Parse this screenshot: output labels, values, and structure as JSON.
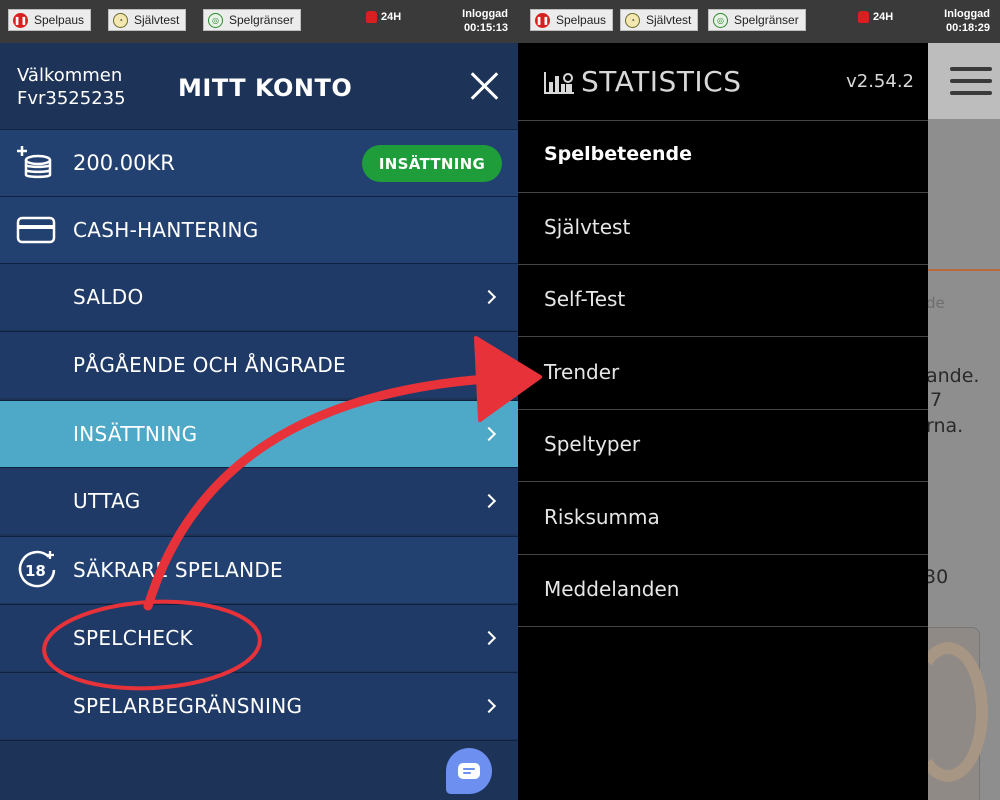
{
  "topbar_left": {
    "spelpaus": "Spelpaus",
    "sjalvtest": "Självtest",
    "spelgranser": "Spelgränser",
    "h24": "24H",
    "login_label": "Inloggad",
    "login_time": "00:15:13"
  },
  "topbar_right": {
    "spelpaus": "Spelpaus",
    "sjalvtest": "Självtest",
    "spelgranser": "Spelgränser",
    "h24": "24H",
    "login_label": "Inloggad",
    "login_time": "00:18:29"
  },
  "menu": {
    "welcome": "Välkommen",
    "username": "Fvr3525235",
    "title": "MITT KONTO",
    "balance": "200.00KR",
    "deposit_button": "INSÄTTNING",
    "items": [
      {
        "label": "CASH-HANTERING"
      },
      {
        "label": "SALDO"
      },
      {
        "label": "PÅGÅENDE OCH ÅNGRADE"
      },
      {
        "label": "INSÄTTNING"
      },
      {
        "label": "UTTAG"
      },
      {
        "label": "SÄKRARE SPELANDE"
      },
      {
        "label": "SPELCHECK"
      },
      {
        "label": "SPELARBEGRÄNSNING"
      }
    ]
  },
  "stats": {
    "title": "STATISTICS",
    "version": "v2.54.2",
    "items": [
      {
        "label": "Spelbeteende"
      },
      {
        "label": "Självtest"
      },
      {
        "label": "Self-Test"
      },
      {
        "label": "Trender"
      },
      {
        "label": "Speltyper"
      },
      {
        "label": "Risksumma"
      },
      {
        "label": "Meddelanden"
      }
    ]
  },
  "background_page": {
    "frag1": "de",
    "frag2": "ande.",
    "frag3": "7",
    "frag4": "rna.",
    "frag5": "30"
  },
  "colors": {
    "menu_bg": "#1d3358",
    "active_row": "#4ea8c8",
    "deposit_green": "#1f9d3a",
    "annotation_red": "#e8323a"
  }
}
